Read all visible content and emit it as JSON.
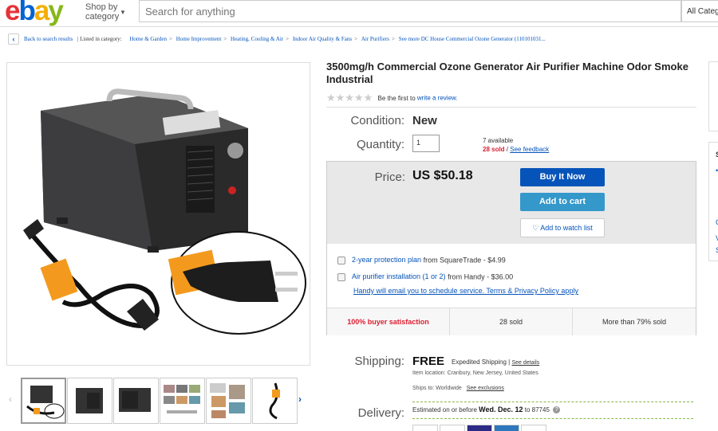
{
  "header": {
    "logo": {
      "e": "e",
      "b": "b",
      "a": "a",
      "y": "y"
    },
    "shop_by_line1": "Shop by",
    "shop_by_line2": "category",
    "search_placeholder": "Search for anything",
    "category_select": "All Categories"
  },
  "breadcrumb": {
    "back_label": "Back to search results",
    "listed_label": "| Listed in category:",
    "items": [
      "Home & Garden",
      "Heating, Cooling & Air",
      "Indoor Air Quality & Fans",
      "Air Purifiers",
      "See more DC House Commercial Ozone Generator (110101031..."
    ],
    "home_improvement": "Home Improvement"
  },
  "product": {
    "title": "3500mg/h Commercial Ozone Generator Air Purifier Machine Odor Smoke Industrial",
    "rating_text": "Be the first to",
    "review_link": "write a review.",
    "condition_label": "Condition:",
    "condition_value": "New",
    "quantity_label": "Quantity:",
    "quantity_value": "1",
    "available": "7 available",
    "sold": "28 sold",
    "feedback_link": "See feedback"
  },
  "price_box": {
    "price_label": "Price:",
    "price_value": "US $50.18",
    "buy_now": "Buy It Now",
    "add_to_cart": "Add to cart",
    "watch": "Add to watch list",
    "option1_link": "2-year protection plan",
    "option1_rest": "from SquareTrade - $4.99",
    "option2_link": "Air purifier installation (1 or 2)",
    "option2_rest": "from Handy - $36.00",
    "handy_note": "Handy will email you to schedule service. Terms & Privacy Policy apply",
    "stats": [
      "100% buyer satisfaction",
      "28 sold",
      "More than 79% sold"
    ]
  },
  "shipping": {
    "shipping_label": "Shipping:",
    "free": "FREE",
    "expedited": "Expedited Shipping |",
    "details": "See details",
    "location": "Item location:  Cranbury, New Jersey, United States",
    "ships_to": "Ships to:  Worldwide",
    "exclusions": "See exclusions",
    "delivery_label": "Delivery:",
    "delivery_pre": "Estimated on or before",
    "delivery_date": "Wed. Dec. 12",
    "delivery_post": "to 87745"
  },
  "colors": {
    "accent_blue": "#0654ba",
    "cart_blue": "#3498ca",
    "sold_red": "#dd1e31"
  }
}
